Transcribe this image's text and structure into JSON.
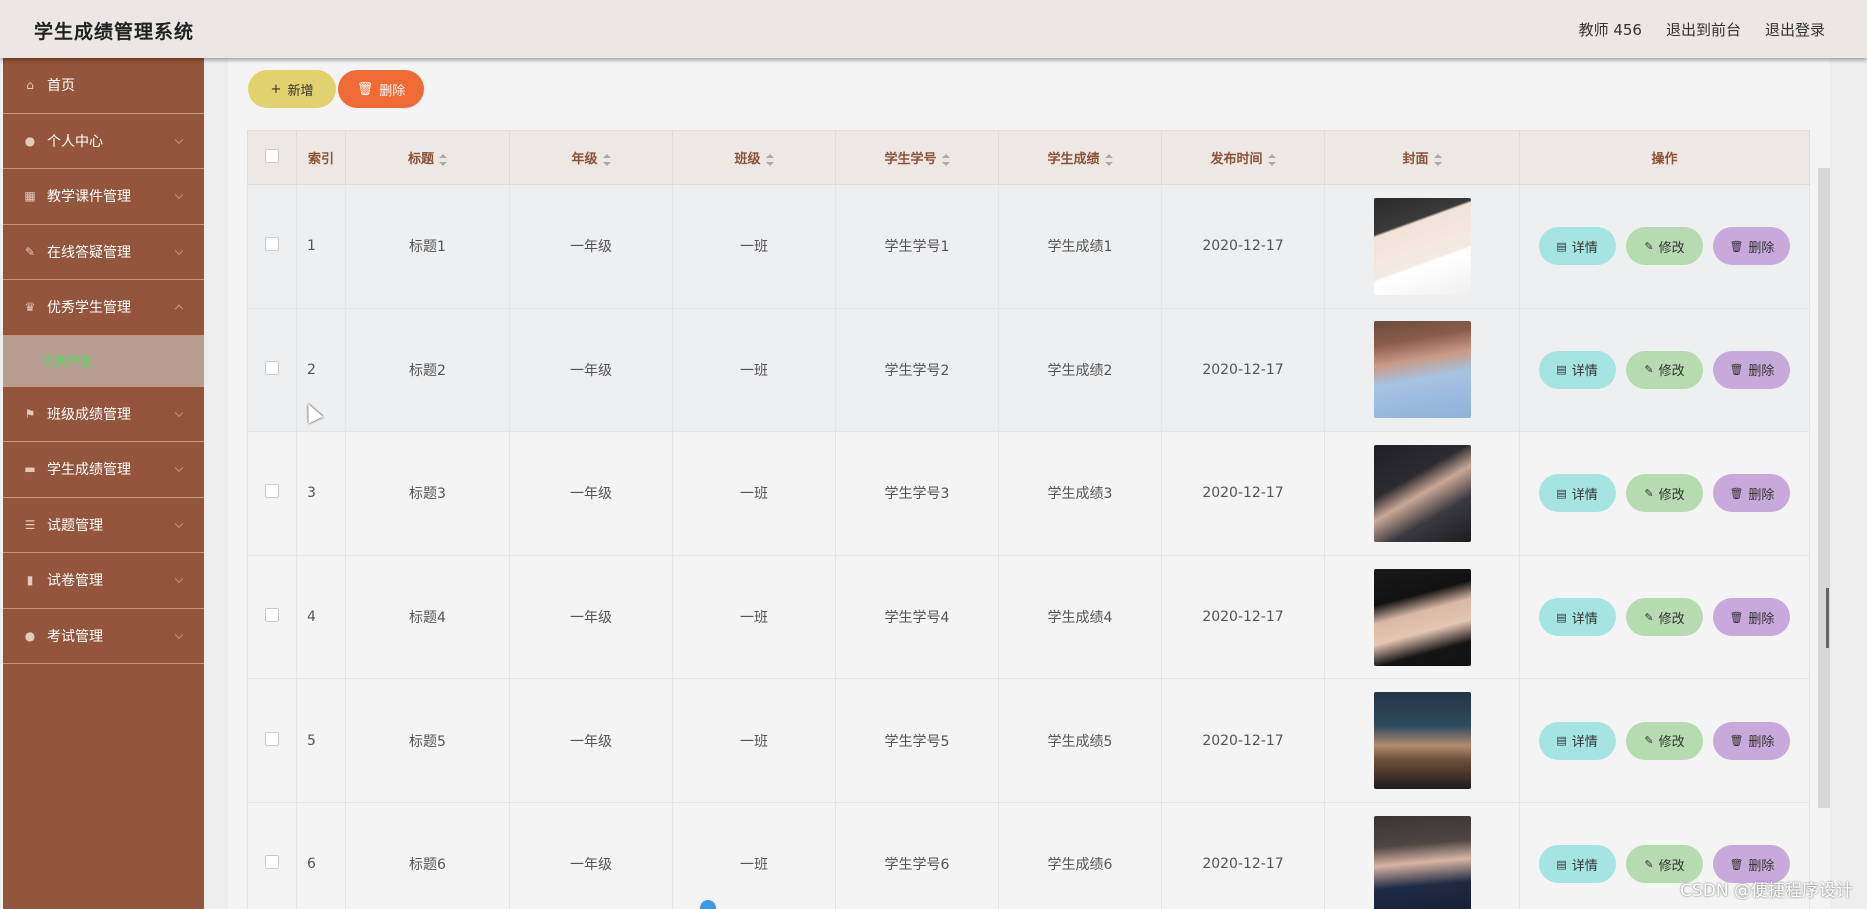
{
  "header": {
    "title": "学生成绩管理系统",
    "user": "教师 456",
    "back_front": "退出到前台",
    "logout": "退出登录"
  },
  "sidebar": {
    "items": [
      {
        "label": "首页",
        "icon": "home-icon"
      },
      {
        "label": "个人中心",
        "icon": "user-icon"
      },
      {
        "label": "教学课件管理",
        "icon": "grid-icon"
      },
      {
        "label": "在线答疑管理",
        "icon": "edit-icon"
      },
      {
        "label": "优秀学生管理",
        "icon": "trophy-icon"
      },
      {
        "label": "班级成绩管理",
        "icon": "flag-icon"
      },
      {
        "label": "学生成绩管理",
        "icon": "book-icon"
      },
      {
        "label": "试题管理",
        "icon": "list-icon"
      },
      {
        "label": "试卷管理",
        "icon": "bar-chart-icon"
      },
      {
        "label": "考试管理",
        "icon": "user-icon"
      }
    ],
    "active_sub": "优秀学生"
  },
  "toolbar": {
    "add_label": "新增",
    "delete_label": "删除"
  },
  "table": {
    "headers": [
      "索引",
      "标题",
      "年级",
      "班级",
      "学生学号",
      "学生成绩",
      "发布时间",
      "封面",
      "操作"
    ],
    "rows": [
      {
        "index": "1",
        "title": "标题1",
        "grade": "一年级",
        "class": "一班",
        "student_no": "学生学号1",
        "score": "学生成绩1",
        "date": "2020-12-17"
      },
      {
        "index": "2",
        "title": "标题2",
        "grade": "一年级",
        "class": "一班",
        "student_no": "学生学号2",
        "score": "学生成绩2",
        "date": "2020-12-17"
      },
      {
        "index": "3",
        "title": "标题3",
        "grade": "一年级",
        "class": "一班",
        "student_no": "学生学号3",
        "score": "学生成绩3",
        "date": "2020-12-17"
      },
      {
        "index": "4",
        "title": "标题4",
        "grade": "一年级",
        "class": "一班",
        "student_no": "学生学号4",
        "score": "学生成绩4",
        "date": "2020-12-17"
      },
      {
        "index": "5",
        "title": "标题5",
        "grade": "一年级",
        "class": "一班",
        "student_no": "学生学号5",
        "score": "学生成绩5",
        "date": "2020-12-17"
      },
      {
        "index": "6",
        "title": "标题6",
        "grade": "一年级",
        "class": "一班",
        "student_no": "学生学号6",
        "score": "学生成绩6",
        "date": "2020-12-17"
      }
    ],
    "ops": {
      "view": "详情",
      "edit": "修改",
      "delete": "删除"
    }
  },
  "watermark": "CSDN @便捷程序设计",
  "colors": {
    "sidebar_bg": "#93553b",
    "header_bg": "#ece6e4",
    "add_button": "#e2d26d",
    "delete_button": "#ef6a35",
    "view_button": "#a6e4e2",
    "edit_button": "#b7dbb1",
    "row_delete_button": "#c7a9db",
    "active_sub_text": "#59d65f"
  }
}
